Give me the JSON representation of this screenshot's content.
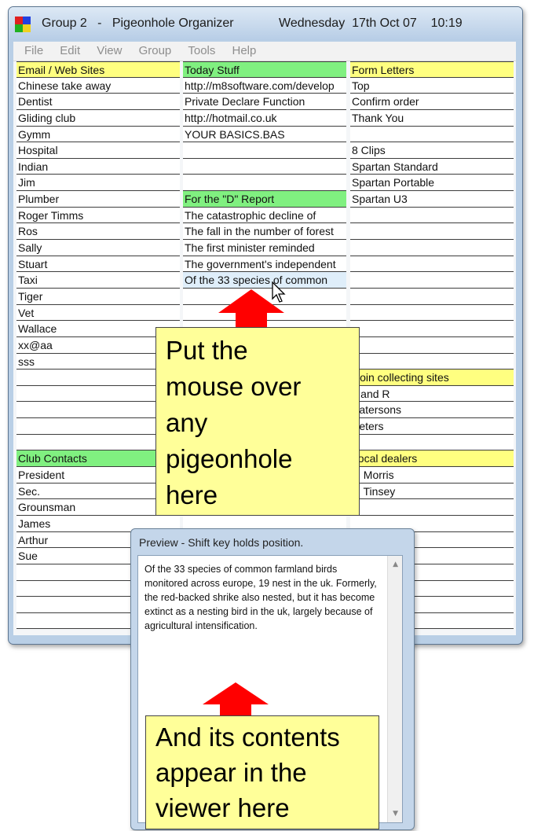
{
  "window": {
    "title_left": "Group 2   -   Pigeonhole Organizer",
    "title_right": "Wednesday  17th Oct 07    10:19"
  },
  "menu": [
    "File",
    "Edit",
    "View",
    "Group",
    "Tools",
    "Help"
  ],
  "columns": [
    {
      "cells": [
        {
          "text": "Email / Web Sites",
          "type": "hdr-y"
        },
        {
          "text": "Chinese take away"
        },
        {
          "text": "Dentist"
        },
        {
          "text": "Gliding club"
        },
        {
          "text": "Gymm"
        },
        {
          "text": "Hospital"
        },
        {
          "text": "Indian"
        },
        {
          "text": "Jim"
        },
        {
          "text": "Plumber"
        },
        {
          "text": "Roger Timms"
        },
        {
          "text": "Ros"
        },
        {
          "text": "Sally"
        },
        {
          "text": "Stuart"
        },
        {
          "text": "Taxi"
        },
        {
          "text": "Tiger"
        },
        {
          "text": "Vet"
        },
        {
          "text": "Wallace"
        },
        {
          "text": "xx@aa"
        },
        {
          "text": "sss"
        },
        {
          "text": ""
        },
        {
          "text": ""
        },
        {
          "text": ""
        },
        {
          "text": ""
        },
        {
          "text": ""
        },
        {
          "text": "Club Contacts",
          "type": "hdr-g"
        },
        {
          "text": "President"
        },
        {
          "text": "Sec."
        },
        {
          "text": "Grounsman"
        },
        {
          "text": "James"
        },
        {
          "text": "Arthur"
        },
        {
          "text": "Sue"
        },
        {
          "text": ""
        },
        {
          "text": ""
        },
        {
          "text": ""
        },
        {
          "text": ""
        }
      ]
    },
    {
      "cells": [
        {
          "text": "Today Stuff",
          "type": "hdr-g"
        },
        {
          "text": "http://m8software.com/develop"
        },
        {
          "text": "Private Declare Function"
        },
        {
          "text": "http://hotmail.co.uk"
        },
        {
          "text": "YOUR BASICS.BAS"
        },
        {
          "text": ""
        },
        {
          "text": ""
        },
        {
          "text": ""
        },
        {
          "text": "For the \"D\" Report",
          "type": "hdr-g"
        },
        {
          "text": "The catastrophic decline of"
        },
        {
          "text": "The fall in the number of forest"
        },
        {
          "text": "The first minister reminded"
        },
        {
          "text": "The government's independent"
        },
        {
          "text": "Of the 33 species of common",
          "type": "hover"
        },
        {
          "text": ""
        },
        {
          "text": ""
        },
        {
          "text": ""
        },
        {
          "text": ""
        },
        {
          "text": ""
        },
        {
          "text": ""
        },
        {
          "text": ""
        },
        {
          "text": ""
        },
        {
          "text": ""
        },
        {
          "text": ""
        },
        {
          "text": ""
        },
        {
          "text": ""
        },
        {
          "text": ""
        },
        {
          "text": ""
        },
        {
          "text": ""
        },
        {
          "text": ""
        },
        {
          "text": ""
        },
        {
          "text": ""
        },
        {
          "text": ""
        },
        {
          "text": ""
        },
        {
          "text": ""
        }
      ]
    },
    {
      "cells": [
        {
          "text": "Form Letters",
          "type": "hdr-y"
        },
        {
          "text": "Top"
        },
        {
          "text": "Confirm order"
        },
        {
          "text": "Thank You"
        },
        {
          "text": ""
        },
        {
          "text": "8 Clips"
        },
        {
          "text": "Spartan Standard"
        },
        {
          "text": "Spartan Portable"
        },
        {
          "text": "Spartan U3"
        },
        {
          "text": ""
        },
        {
          "text": ""
        },
        {
          "text": ""
        },
        {
          "text": ""
        },
        {
          "text": ""
        },
        {
          "text": ""
        },
        {
          "text": ""
        },
        {
          "text": ""
        },
        {
          "text": ""
        },
        {
          "text": ""
        },
        {
          "text": "Coin collecting sites",
          "type": "hdr-y"
        },
        {
          "text": "L and R"
        },
        {
          "text": "Patersons"
        },
        {
          "text": "Peters"
        },
        {
          "text": ""
        },
        {
          "text": "Local dealers",
          "type": "hdr-y"
        },
        {
          "text": "J. Morris"
        },
        {
          "text": "F. Tinsey"
        },
        {
          "text": ""
        },
        {
          "text": ""
        },
        {
          "text": ""
        },
        {
          "text": ""
        },
        {
          "text": ""
        },
        {
          "text": ""
        },
        {
          "text": ""
        },
        {
          "text": ""
        }
      ]
    }
  ],
  "callout_top": [
    "Put the",
    "mouse over",
    "any",
    "pigeonhole",
    "here"
  ],
  "callout_bottom": [
    "And its contents",
    "appear in the",
    "viewer here"
  ],
  "preview": {
    "title": "Preview - Shift key holds position.",
    "text": "Of the 33 species of common farmland birds monitored across europe, 19 nest in the uk. Formerly, the red-backed shrike also nested, but it has become extinct as a nesting bird in the uk, largely because of agricultural intensification."
  },
  "colors": {
    "header_yellow": "#ffff80",
    "header_green": "#80f080",
    "callout": "#ffff99",
    "arrow": "#ff0000"
  }
}
